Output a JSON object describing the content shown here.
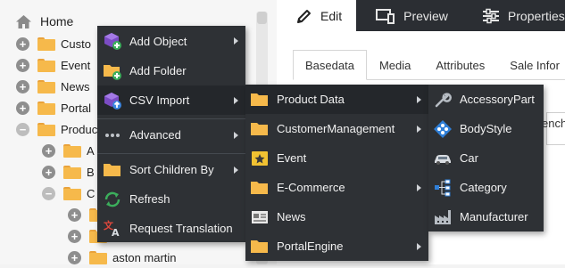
{
  "tree": {
    "home_label": "Home",
    "rows": [
      {
        "label": "Custo",
        "toggle": "+"
      },
      {
        "label": "Event",
        "toggle": "+"
      },
      {
        "label": "News",
        "toggle": "+"
      },
      {
        "label": "Portal",
        "toggle": "+"
      },
      {
        "label": "Produc",
        "toggle": "−"
      },
      {
        "label": "A",
        "toggle": "+"
      },
      {
        "label": "B",
        "toggle": "+"
      },
      {
        "label": "C",
        "toggle": "−"
      },
      {
        "label": "",
        "toggle": "+"
      },
      {
        "label": "",
        "toggle": "+"
      },
      {
        "label": "aston martin",
        "toggle": "+"
      }
    ]
  },
  "editor": {
    "tabs": [
      {
        "label": "Edit",
        "icon": "pencil-icon"
      },
      {
        "label": "Preview",
        "icon": "devices-icon"
      },
      {
        "label": "Properties",
        "icon": "sliders-icon"
      }
    ],
    "subtabs": [
      "Basedata",
      "Media",
      "Attributes",
      "Sale Infor"
    ],
    "partial_field_text": "ench"
  },
  "menu1": {
    "items": [
      {
        "label": "Add Object",
        "icon": "add-object-icon",
        "submenu": true
      },
      {
        "label": "Add Folder",
        "icon": "add-folder-icon",
        "submenu": false
      },
      {
        "label": "CSV Import",
        "icon": "csv-import-icon",
        "submenu": true
      },
      {
        "label": "Advanced",
        "icon": "more-icon",
        "submenu": true
      },
      {
        "label": "Sort Children By",
        "icon": "sort-folder-icon",
        "submenu": true
      },
      {
        "label": "Refresh",
        "icon": "refresh-icon",
        "submenu": false
      },
      {
        "label": "Request Translation",
        "icon": "translate-icon",
        "submenu": false
      }
    ]
  },
  "menu2": {
    "items": [
      {
        "label": "Product Data",
        "icon": "folder-icon",
        "submenu": true
      },
      {
        "label": "CustomerManagement",
        "icon": "folder-icon",
        "submenu": true
      },
      {
        "label": "Event",
        "icon": "star-icon",
        "submenu": false
      },
      {
        "label": "E-Commerce",
        "icon": "folder-icon",
        "submenu": true
      },
      {
        "label": "News",
        "icon": "news-icon",
        "submenu": false
      },
      {
        "label": "PortalEngine",
        "icon": "folder-icon",
        "submenu": true
      }
    ]
  },
  "menu3": {
    "items": [
      {
        "label": "AccessoryPart",
        "icon": "wrench-icon"
      },
      {
        "label": "BodyStyle",
        "icon": "body-style-icon"
      },
      {
        "label": "Car",
        "icon": "car-icon"
      },
      {
        "label": "Category",
        "icon": "category-icon"
      },
      {
        "label": "Manufacturer",
        "icon": "factory-icon"
      }
    ]
  },
  "colors": {
    "menu_bg": "#2e3135",
    "menu_highlight": "#24272b",
    "folder": "#f6b94b",
    "tabbar_bg": "#2b2e33"
  }
}
